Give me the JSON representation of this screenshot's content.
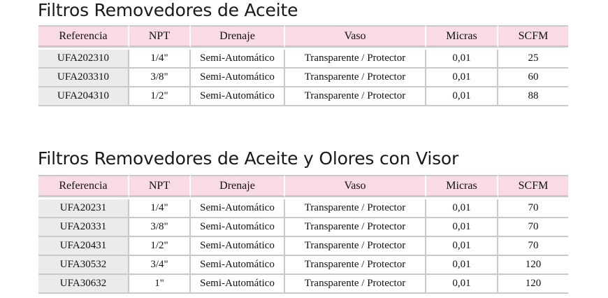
{
  "tables": [
    {
      "title": "Filtros Removedores de Aceite",
      "headers": [
        "Referencia",
        "NPT",
        "Drenaje",
        "Vaso",
        "Micras",
        "SCFM"
      ],
      "rows": [
        [
          "UFA202310",
          "1/4\"",
          "Semi-Automático",
          "Transparente / Protector",
          "0,01",
          "25"
        ],
        [
          "UFA203310",
          "3/8\"",
          "Semi-Automático",
          "Transparente / Protector",
          "0,01",
          "60"
        ],
        [
          "UFA204310",
          "1/2\"",
          "Semi-Automático",
          "Transparente / Protector",
          "0,01",
          "88"
        ]
      ]
    },
    {
      "title": "Filtros Removedores de Aceite y Olores con Visor",
      "headers": [
        "Referencia",
        "NPT",
        "Drenaje",
        "Vaso",
        "Micras",
        "SCFM"
      ],
      "rows": [
        [
          "UFA20231",
          "1/4\"",
          "Semi-Automático",
          "Transparente / Protector",
          "0,01",
          "70"
        ],
        [
          "UFA20331",
          "3/8\"",
          "Semi-Automático",
          "Transparente / Protector",
          "0,01",
          "70"
        ],
        [
          "UFA20431",
          "1/2\"",
          "Semi-Automático",
          "Transparente / Protector",
          "0,01",
          "70"
        ],
        [
          "UFA30532",
          "3/4\"",
          "Semi-Automático",
          "Transparente / Protector",
          "0,01",
          "120"
        ],
        [
          "UFA30632",
          "1\"",
          "Semi-Automático",
          "Transparente / Protector",
          "0,01",
          "120"
        ]
      ]
    }
  ]
}
